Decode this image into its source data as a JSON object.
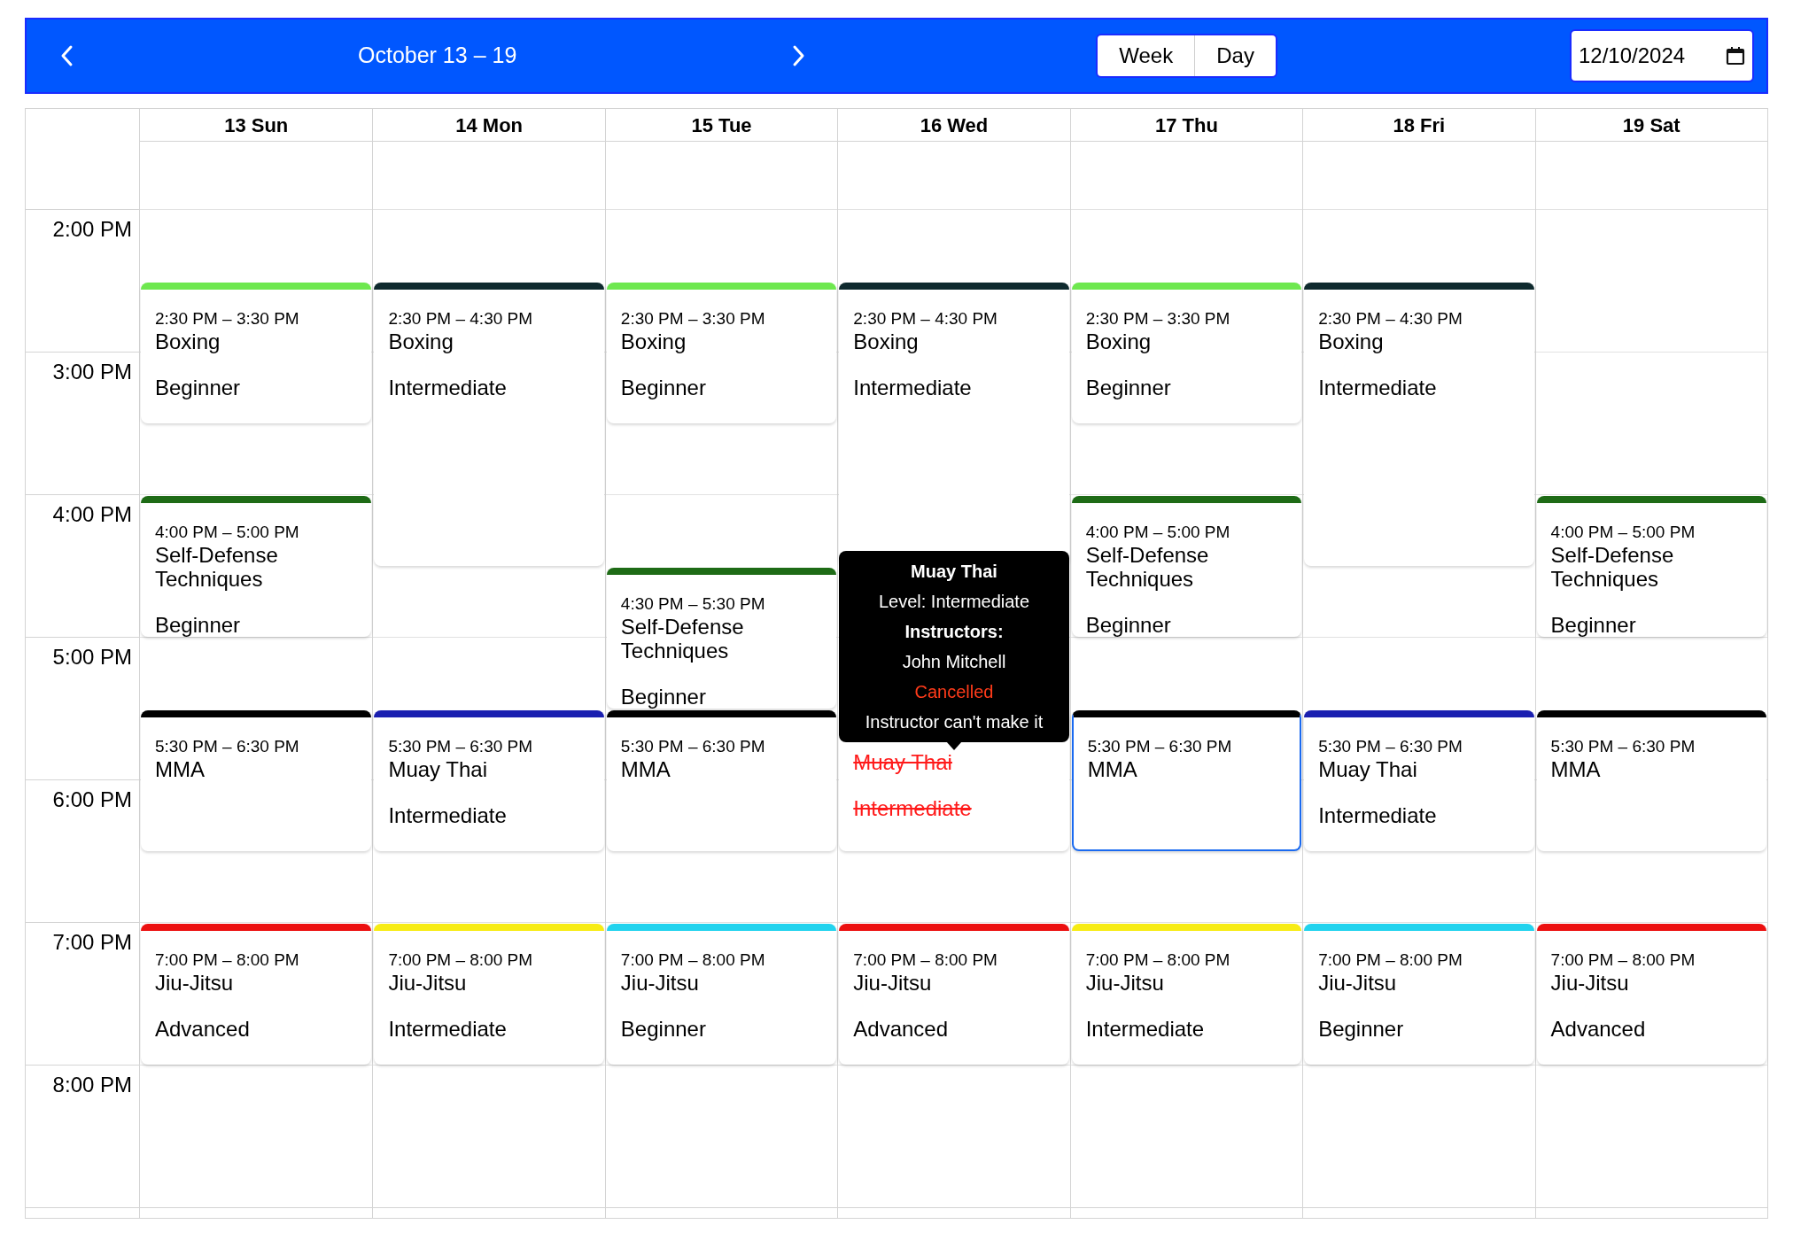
{
  "toolbar": {
    "title": "October 13 – 19",
    "views": [
      "Week",
      "Day"
    ],
    "date_value": "12/10/2024"
  },
  "hours": [
    "2:00 PM",
    "3:00 PM",
    "4:00 PM",
    "5:00 PM",
    "6:00 PM",
    "7:00 PM",
    "8:00 PM"
  ],
  "days": [
    {
      "label": "13 Sun",
      "events": [
        {
          "time": "2:30 PM – 3:30 PM",
          "title": "Boxing",
          "level": "Beginner",
          "color": "#6ee84f",
          "selected": false,
          "cancelled": false
        },
        {
          "time": "4:00 PM – 5:00 PM",
          "title": "Self-Defense Techniques",
          "level": "Beginner",
          "color": "#1e6b16",
          "selected": false,
          "cancelled": false
        },
        {
          "time": "5:30 PM – 6:30 PM",
          "title": "MMA",
          "color": "#000000",
          "selected": false,
          "cancelled": false
        },
        {
          "time": "7:00 PM – 8:00 PM",
          "title": "Jiu-Jitsu",
          "level": "Advanced",
          "color": "#ec1010",
          "selected": false,
          "cancelled": false
        }
      ]
    },
    {
      "label": "14 Mon",
      "events": [
        {
          "time": "2:30 PM – 4:30 PM",
          "title": "Boxing",
          "level": "Intermediate",
          "color": "#0f2a2e",
          "selected": false,
          "cancelled": false
        },
        {
          "time": "5:30 PM – 6:30 PM",
          "title": "Muay Thai",
          "level": "Intermediate",
          "color": "#1a1fb0",
          "selected": false,
          "cancelled": false
        },
        {
          "time": "7:00 PM – 8:00 PM",
          "title": "Jiu-Jitsu",
          "level": "Intermediate",
          "color": "#f7ec14",
          "selected": false,
          "cancelled": false
        }
      ]
    },
    {
      "label": "15 Tue",
      "events": [
        {
          "time": "2:30 PM – 3:30 PM",
          "title": "Boxing",
          "level": "Beginner",
          "color": "#6ee84f",
          "selected": false,
          "cancelled": false
        },
        {
          "time": "4:30 PM – 5:30 PM",
          "title": "Self-Defense Techniques",
          "level": "Beginner",
          "color": "#1e6b16",
          "selected": false,
          "cancelled": false
        },
        {
          "time": "5:30 PM – 6:30 PM",
          "title": "MMA",
          "color": "#000000",
          "selected": false,
          "cancelled": false
        },
        {
          "time": "7:00 PM – 8:00 PM",
          "title": "Jiu-Jitsu",
          "level": "Beginner",
          "color": "#22d3ee",
          "selected": false,
          "cancelled": false
        }
      ]
    },
    {
      "label": "16 Wed",
      "events": [
        {
          "time": "2:30 PM – 4:30 PM",
          "title": "Boxing",
          "level": "Intermediate",
          "color": "#0f2a2e",
          "selected": false,
          "cancelled": false
        },
        {
          "title": "Muay Thai",
          "level": "Intermediate",
          "selected": false,
          "cancelled": true,
          "tooltip": {
            "title": "Muay Thai",
            "level": "Level: Intermediate",
            "instructors_label": "Instructors:",
            "instructor": "John Mitchell",
            "status": "Cancelled",
            "reason": "Instructor can't make it"
          }
        },
        {
          "time": "7:00 PM – 8:00 PM",
          "title": "Jiu-Jitsu",
          "level": "Advanced",
          "color": "#ec1010",
          "selected": false,
          "cancelled": false
        }
      ]
    },
    {
      "label": "17 Thu",
      "events": [
        {
          "time": "2:30 PM – 3:30 PM",
          "title": "Boxing",
          "level": "Beginner",
          "color": "#6ee84f",
          "selected": false,
          "cancelled": false
        },
        {
          "time": "4:00 PM – 5:00 PM",
          "title": "Self-Defense Techniques",
          "level": "Beginner",
          "color": "#1e6b16",
          "selected": false,
          "cancelled": false
        },
        {
          "time": "5:30 PM – 6:30 PM",
          "title": "MMA",
          "color": "#000000",
          "selected": true,
          "cancelled": false
        },
        {
          "time": "7:00 PM – 8:00 PM",
          "title": "Jiu-Jitsu",
          "level": "Intermediate",
          "color": "#f7ec14",
          "selected": false,
          "cancelled": false
        }
      ]
    },
    {
      "label": "18 Fri",
      "events": [
        {
          "time": "2:30 PM – 4:30 PM",
          "title": "Boxing",
          "level": "Intermediate",
          "color": "#0f2a2e",
          "selected": false,
          "cancelled": false
        },
        {
          "time": "5:30 PM – 6:30 PM",
          "title": "Muay Thai",
          "level": "Intermediate",
          "color": "#1a1fb0",
          "selected": false,
          "cancelled": false
        },
        {
          "time": "7:00 PM – 8:00 PM",
          "title": "Jiu-Jitsu",
          "level": "Beginner",
          "color": "#22d3ee",
          "selected": false,
          "cancelled": false
        }
      ]
    },
    {
      "label": "19 Sat",
      "events": [
        {
          "time": "4:00 PM – 5:00 PM",
          "title": "Self-Defense Techniques",
          "level": "Beginner",
          "color": "#1e6b16",
          "selected": false,
          "cancelled": false
        },
        {
          "time": "5:30 PM – 6:30 PM",
          "title": "MMA",
          "color": "#000000",
          "selected": false,
          "cancelled": false
        },
        {
          "time": "7:00 PM – 8:00 PM",
          "title": "Jiu-Jitsu",
          "level": "Advanced",
          "color": "#ec1010",
          "selected": false,
          "cancelled": false
        }
      ]
    }
  ]
}
